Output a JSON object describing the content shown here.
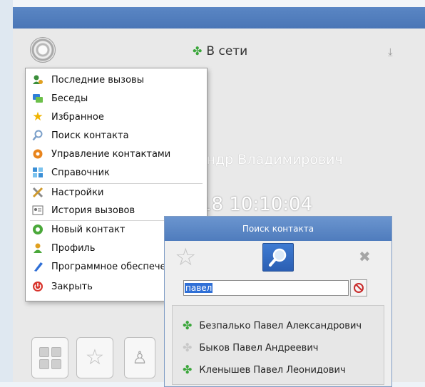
{
  "main": {
    "status": "В сети",
    "bg_name": "андр Владимирович",
    "bg_clock": "18 10:10:04"
  },
  "menu": {
    "items": [
      {
        "label": "Последние вызовы",
        "icon": "recent-calls-icon"
      },
      {
        "label": "Беседы",
        "icon": "chats-icon"
      },
      {
        "label": "Избранное",
        "icon": "favorites-star-icon"
      },
      {
        "label": "Поиск контакта",
        "icon": "search-icon"
      },
      {
        "label": "Управление контактами",
        "icon": "contacts-manage-icon"
      },
      {
        "label": "Справочник",
        "icon": "directory-icon"
      },
      {
        "label": "Настройки",
        "icon": "settings-tools-icon"
      },
      {
        "label": "История вызовов",
        "icon": "call-history-icon"
      },
      {
        "label": "Новый контакт",
        "icon": "new-contact-icon"
      },
      {
        "label": "Профиль",
        "icon": "profile-icon"
      },
      {
        "label": "Программное обеспече",
        "icon": "software-icon"
      },
      {
        "label": "Закрыть",
        "icon": "close-power-icon"
      }
    ]
  },
  "dialog": {
    "title": "Поиск контакта",
    "search_value": "павел",
    "results": [
      {
        "name": "Безпалько Павел Александрович",
        "status": "online"
      },
      {
        "name": "Быков Павел Андреевич",
        "status": "offline"
      },
      {
        "name": "Кленышев Павел Леонидович",
        "status": "online"
      }
    ]
  },
  "colors": {
    "titlebar": "#4a76b6",
    "online": "#3aa63a",
    "offline": "#c8c8c8",
    "selection": "#2f6fd6"
  }
}
